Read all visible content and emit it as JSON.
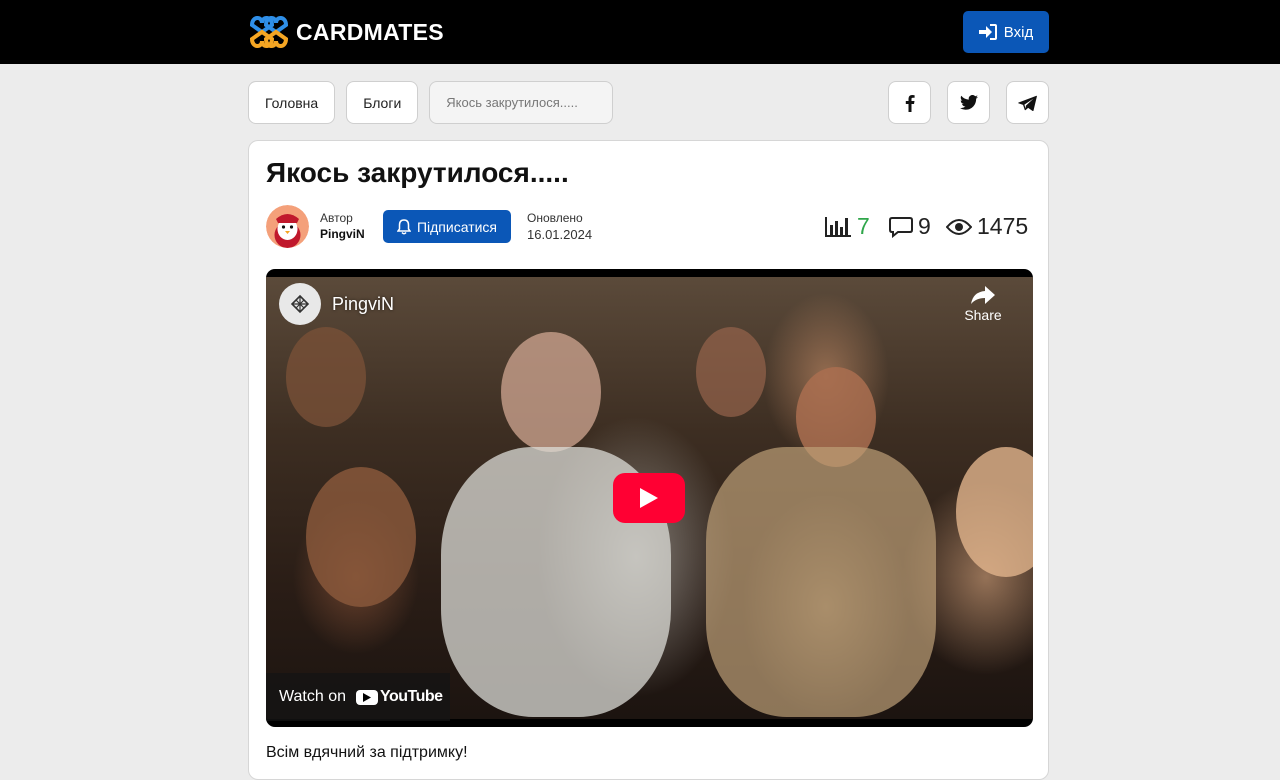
{
  "header": {
    "brand": "CARDMATES",
    "login_label": "Вхід",
    "colors": {
      "background": "#000000",
      "accent": "#0b57b7",
      "logo_blue": "#2f8fe8",
      "logo_orange": "#f5a623"
    }
  },
  "breadcrumbs": [
    {
      "label": "Головна"
    },
    {
      "label": "Блоги"
    },
    {
      "label": "Якось закрутилося....."
    }
  ],
  "social": [
    "facebook-icon",
    "twitter-icon",
    "telegram-icon"
  ],
  "post": {
    "title": "Якось закрутилося.....",
    "author_label": "Автор",
    "author_name": "PingviN",
    "subscribe_label": "Підписатися",
    "updated_label": "Оновлено",
    "updated_date": "16.01.2024",
    "stats": {
      "rank": "7",
      "comments": "9",
      "views": "1475"
    },
    "body": "Всім вдячний за підтримку!"
  },
  "video": {
    "channel": "PingviN",
    "share_label": "Share",
    "watch_on": "Watch on",
    "youtube": "YouTube",
    "play_color": "#ff0033"
  }
}
